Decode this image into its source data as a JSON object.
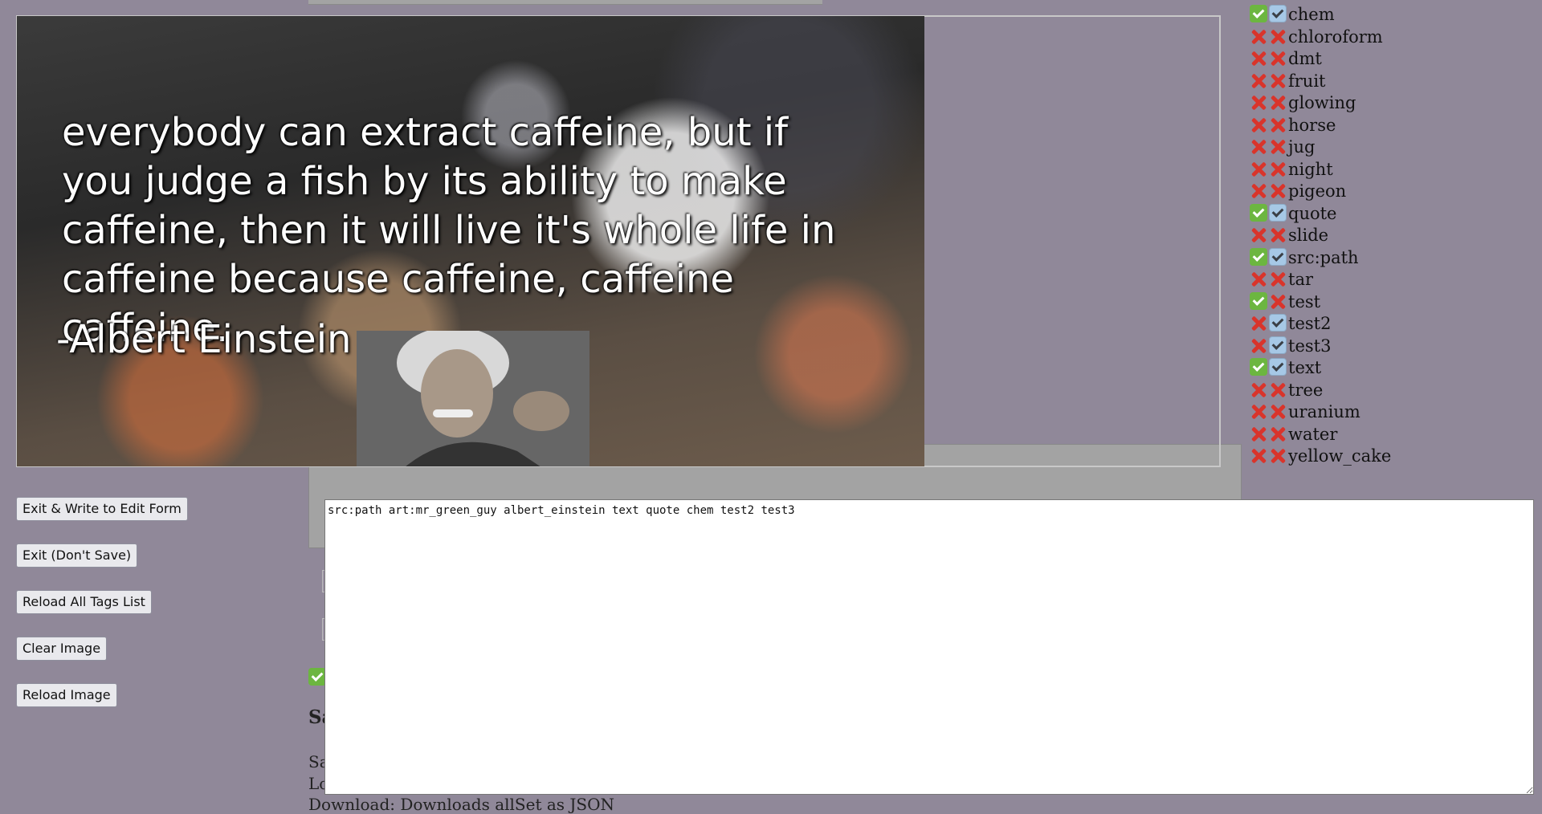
{
  "viewer": {
    "quote_lines": "everybody can extract caffeine, but if you judge a fish by its ability to make caffeine, then it will live it's whole life in caffeine because caffeine, caffeine caffeine.",
    "quote_author": "-Albert Einstein"
  },
  "buttons": {
    "exit_write": "Exit & Write to Edit Form",
    "exit_no_save": "Exit (Don't Save)",
    "reload_tags": "Reload All Tags List",
    "clear_image": "Clear Image",
    "reload_image": "Reload Image"
  },
  "tags_textarea": {
    "value": "src:path art:mr_green_guy albert_einstein text quote chem test2 test3"
  },
  "tags": [
    {
      "name": "chem",
      "mark1": "green",
      "mark2": "blue"
    },
    {
      "name": "chloroform",
      "mark1": "x",
      "mark2": "x"
    },
    {
      "name": "dmt",
      "mark1": "x",
      "mark2": "x"
    },
    {
      "name": "fruit",
      "mark1": "x",
      "mark2": "x"
    },
    {
      "name": "glowing",
      "mark1": "x",
      "mark2": "x"
    },
    {
      "name": "horse",
      "mark1": "x",
      "mark2": "x"
    },
    {
      "name": "jug",
      "mark1": "x",
      "mark2": "x"
    },
    {
      "name": "night",
      "mark1": "x",
      "mark2": "x"
    },
    {
      "name": "pigeon",
      "mark1": "x",
      "mark2": "x"
    },
    {
      "name": "quote",
      "mark1": "green",
      "mark2": "blue"
    },
    {
      "name": "slide",
      "mark1": "x",
      "mark2": "x"
    },
    {
      "name": "src:path",
      "mark1": "green",
      "mark2": "blue"
    },
    {
      "name": "tar",
      "mark1": "x",
      "mark2": "x"
    },
    {
      "name": "test",
      "mark1": "green",
      "mark2": "x"
    },
    {
      "name": "test2",
      "mark1": "x",
      "mark2": "blue"
    },
    {
      "name": "test3",
      "mark1": "x",
      "mark2": "blue"
    },
    {
      "name": "text",
      "mark1": "green",
      "mark2": "blue"
    },
    {
      "name": "tree",
      "mark1": "x",
      "mark2": "x"
    },
    {
      "name": "uranium",
      "mark1": "x",
      "mark2": "x"
    },
    {
      "name": "water",
      "mark1": "x",
      "mark2": "x"
    },
    {
      "name": "yellow_cake",
      "mark1": "x",
      "mark2": "x"
    }
  ],
  "background_page": {
    "heading": "Sa",
    "line1": "Sa",
    "line2": "Lo",
    "line3": "Download: Downloads allSet as JSON"
  }
}
